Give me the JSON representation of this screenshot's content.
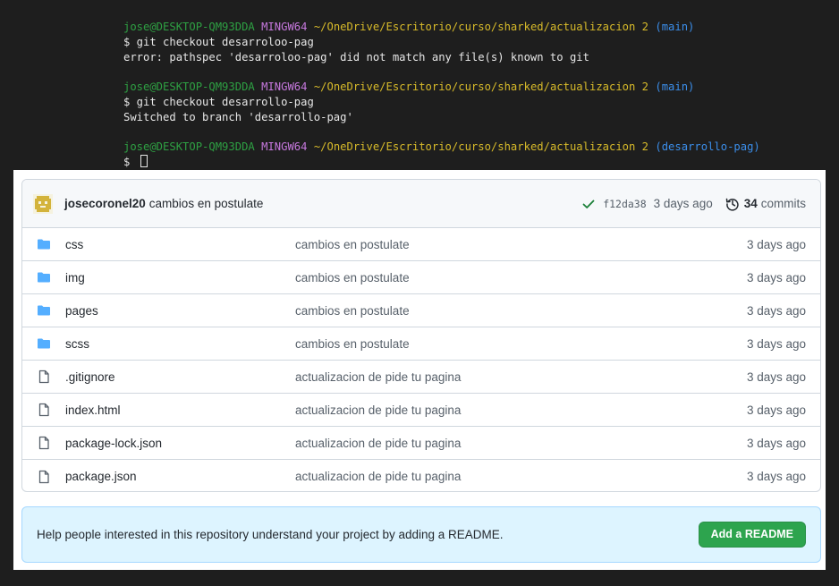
{
  "terminal": {
    "blocks": [
      {
        "prompt": {
          "user": "jose@DESKTOP-QM93DDA",
          "env": "MINGW64",
          "path": "~/OneDrive/Escritorio/curso/sharked/actualizacion 2",
          "branch": "(main)"
        },
        "command": "$ git checkout desarroloo-pag",
        "output": "error: pathspec 'desarroloo-pag' did not match any file(s) known to git"
      },
      {
        "prompt": {
          "user": "jose@DESKTOP-QM93DDA",
          "env": "MINGW64",
          "path": "~/OneDrive/Escritorio/curso/sharked/actualizacion 2",
          "branch": "(main)"
        },
        "command": "$ git checkout desarrollo-pag",
        "output": "Switched to branch 'desarrollo-pag'"
      },
      {
        "prompt": {
          "user": "jose@DESKTOP-QM93DDA",
          "env": "MINGW64",
          "path": "~/OneDrive/Escritorio/curso/sharked/actualizacion 2",
          "branch": "(desarrollo-pag)"
        },
        "command": "$ "
      }
    ]
  },
  "repo": {
    "latest_commit": {
      "author": "josecoronel20",
      "message": "cambios en postulate",
      "sha": "f12da38",
      "age": "3 days ago",
      "commits_count": "34",
      "commits_label": "commits",
      "status_icon": "check-icon",
      "history_icon": "history-icon"
    },
    "files": [
      {
        "type": "folder",
        "icon": "folder-icon",
        "name": "css",
        "commit": "cambios en postulate",
        "age": "3 days ago"
      },
      {
        "type": "folder",
        "icon": "folder-icon",
        "name": "img",
        "commit": "cambios en postulate",
        "age": "3 days ago"
      },
      {
        "type": "folder",
        "icon": "folder-icon",
        "name": "pages",
        "commit": "cambios en postulate",
        "age": "3 days ago"
      },
      {
        "type": "folder",
        "icon": "folder-icon",
        "name": "scss",
        "commit": "cambios en postulate",
        "age": "3 days ago"
      },
      {
        "type": "file",
        "icon": "file-icon",
        "name": ".gitignore",
        "commit": "actualizacion de pide tu pagina",
        "age": "3 days ago"
      },
      {
        "type": "file",
        "icon": "file-icon",
        "name": "index.html",
        "commit": "actualizacion de pide tu pagina",
        "age": "3 days ago"
      },
      {
        "type": "file",
        "icon": "file-icon",
        "name": "package-lock.json",
        "commit": "actualizacion de pide tu pagina",
        "age": "3 days ago"
      },
      {
        "type": "file",
        "icon": "file-icon",
        "name": "package.json",
        "commit": "actualizacion de pide tu pagina",
        "age": "3 days ago"
      }
    ],
    "readme_banner": {
      "text": "Help people interested in this repository understand your project by adding a README.",
      "button_label": "Add a README"
    }
  },
  "colors": {
    "terminal_bg": "#1e1e1e",
    "prompt_user": "#2ea043",
    "prompt_env": "#c678dd",
    "prompt_path": "#d7ba2a",
    "prompt_branch": "#3b8eea",
    "folder_icon": "#54aeff",
    "check_icon": "#1a7f37",
    "readme_bg": "#ddf4ff",
    "button_bg": "#2da44e"
  }
}
